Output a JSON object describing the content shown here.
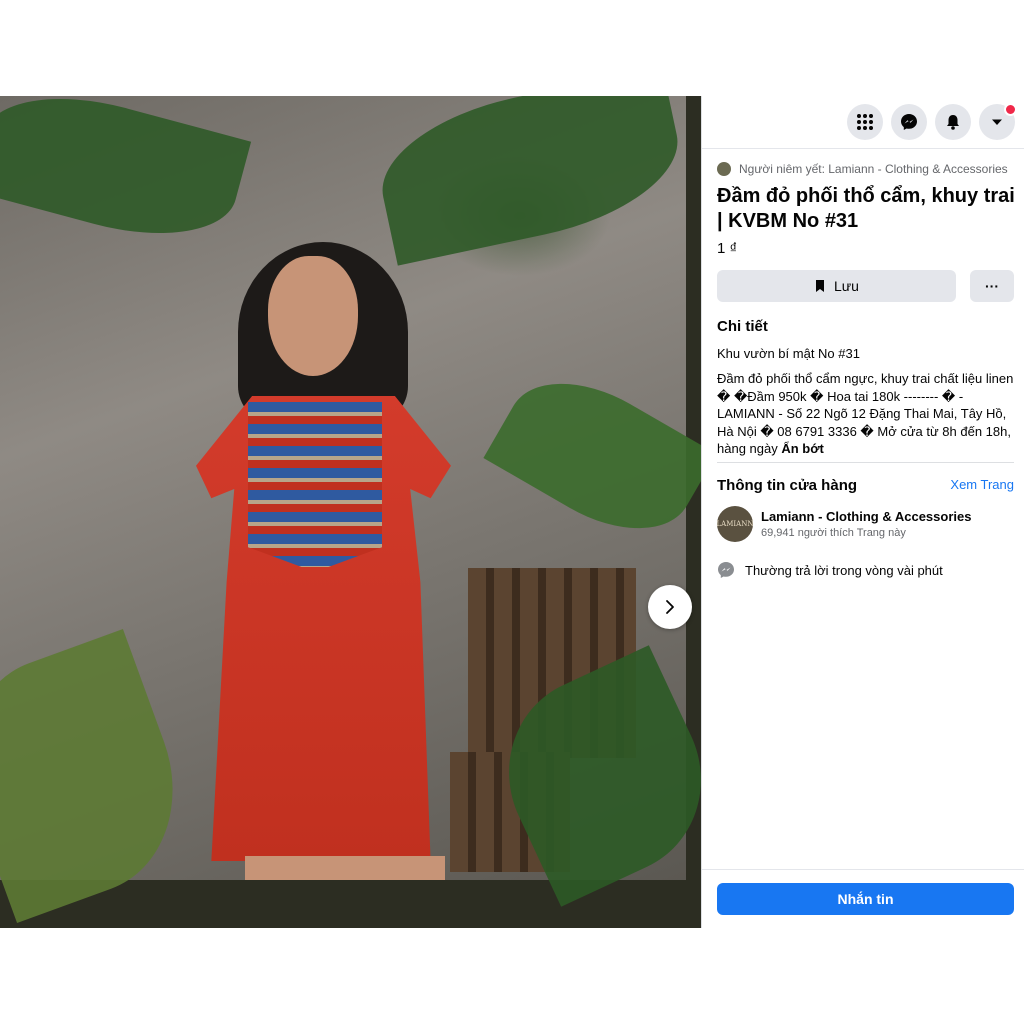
{
  "viewer": {
    "thumbnails": [
      {
        "label": "thumbnail-1",
        "active": true
      },
      {
        "label": "thumbnail-2",
        "active": false
      },
      {
        "label": "thumbnail-3",
        "active": false
      },
      {
        "label": "thumbnail-4",
        "active": false
      }
    ],
    "next_icon": "chevron-right-icon"
  },
  "topbar": {
    "icons": [
      "menu-grid-icon",
      "messenger-icon",
      "bell-icon",
      "caret-down-icon"
    ],
    "notification_color": "#f02849"
  },
  "listing": {
    "seller_line": "Người niêm yết: Lamiann - Clothing & Accessories",
    "title": "Đầm đỏ phối thổ cẩm, khuy trai | KVBM No #31",
    "price": "1 ₫",
    "save_label": "Lưu",
    "more_label": "···"
  },
  "details": {
    "heading": "Chi tiết",
    "subtitle": "Khu vườn bí mật No #31",
    "description": "Đầm đỏ phối thổ cẩm ngực, khuy trai chất liệu linen � �Đầm 950k � Hoa tai 180k -------- � - LAMIANN - Số 22 Ngõ 12 Đặng Thai Mai, Tây Hồ, Hà Nội � 08 6791 3336 � Mở cửa từ 8h đến 18h, hàng ngày",
    "collapse_label": "Ẩn bớt"
  },
  "store": {
    "heading": "Thông tin cửa hàng",
    "see_page": "Xem Trang",
    "avatar_text": "LAMIANN",
    "name": "Lamiann - Clothing & Accessories",
    "likes": "69,941 người thích Trang này",
    "response": "Thường trả lời trong vòng vài phút"
  },
  "actions": {
    "message_label": "Nhắn tin",
    "accent": "#1877f2"
  }
}
